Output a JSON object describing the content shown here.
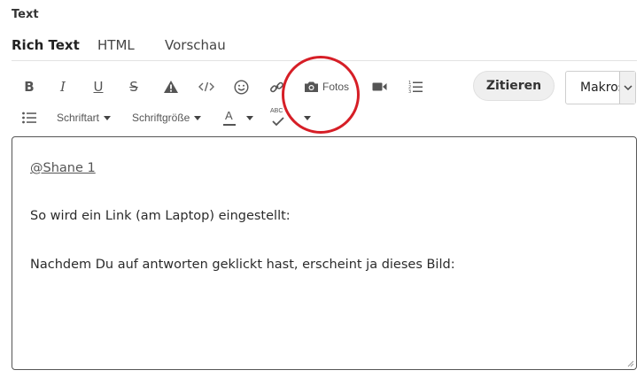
{
  "section": {
    "label": "Text"
  },
  "tabs": [
    {
      "label": "Rich Text",
      "active": true
    },
    {
      "label": "HTML",
      "active": false
    },
    {
      "label": "Vorschau",
      "active": false
    }
  ],
  "toolbar": {
    "row1": [
      {
        "icon": "bold-icon",
        "glyph": "B"
      },
      {
        "icon": "italic-icon",
        "glyph": "I"
      },
      {
        "icon": "underline-icon",
        "glyph": "U"
      },
      {
        "icon": "strikethrough-icon",
        "glyph": "S"
      },
      {
        "icon": "warning-icon"
      },
      {
        "icon": "code-icon"
      },
      {
        "icon": "emoji-icon"
      },
      {
        "icon": "link-icon"
      },
      {
        "icon": "camera-icon",
        "label": "Fotos"
      },
      {
        "icon": "video-icon"
      },
      {
        "icon": "numbered-list-icon"
      }
    ],
    "row2": [
      {
        "icon": "bullet-list-icon"
      },
      {
        "label": "Schriftart"
      },
      {
        "label": "Schriftgröße"
      },
      {
        "icon": "font-color-icon",
        "glyph": "A"
      },
      {
        "icon": "spellcheck-icon",
        "glyph": "ABC"
      }
    ],
    "quote_label": "Zitieren",
    "macro_value": "Makros"
  },
  "editor": {
    "mention": "@Shane 1",
    "line1": "So wird ein Link (am Laptop) eingestellt:",
    "line2": "Nachdem Du auf antworten geklickt hast, erscheint ja dieses Bild:"
  },
  "colors": {
    "highlight": "#d61e26",
    "text": "#333333",
    "border": "#555555"
  }
}
